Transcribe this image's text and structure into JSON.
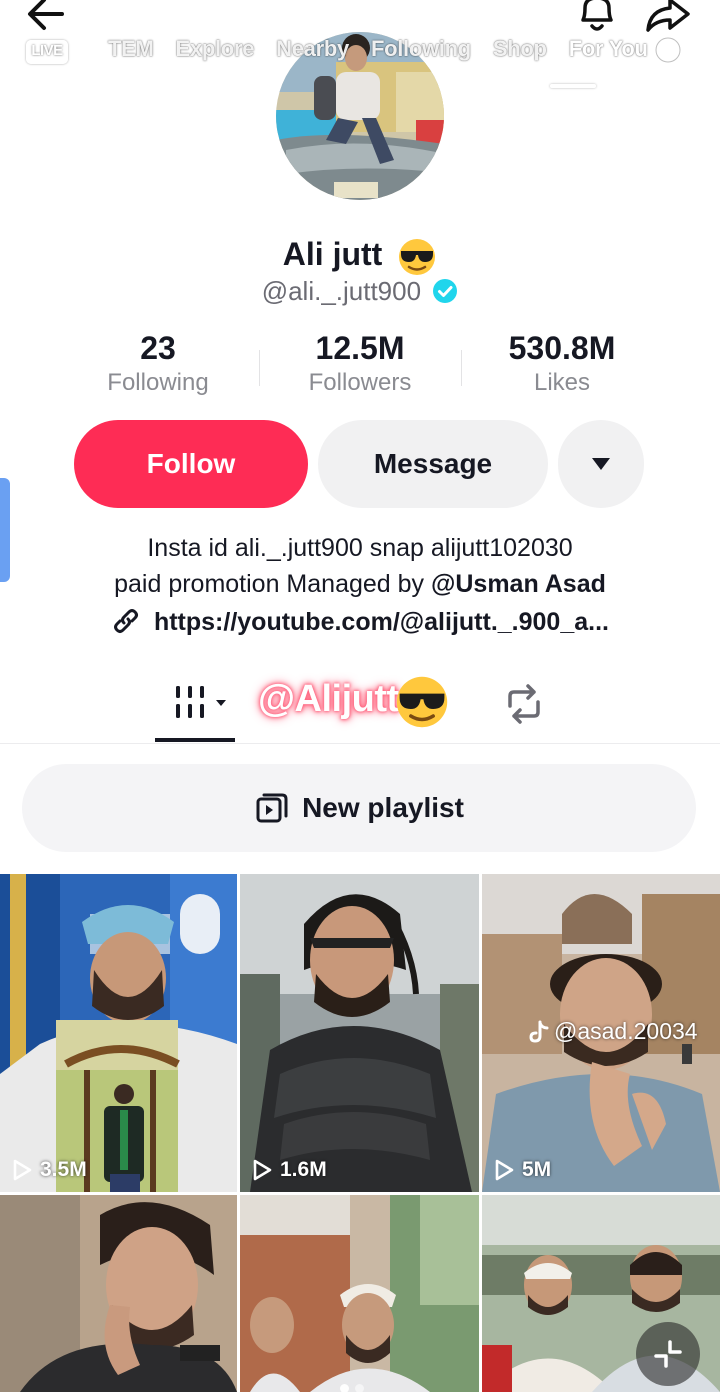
{
  "top_nav": {
    "live_label": "LIVE",
    "tabs": [
      "TEM",
      "Explore",
      "Nearby",
      "Following",
      "Shop",
      "For You"
    ],
    "active_tab": "For You"
  },
  "profile": {
    "name": "Ali jutt",
    "name_emoji": "sunglasses-emoji",
    "handle": "@ali._.jutt900",
    "verified": true
  },
  "stats": [
    {
      "value": "23",
      "label": "Following"
    },
    {
      "value": "12.5M",
      "label": "Followers"
    },
    {
      "value": "530.8M",
      "label": "Likes"
    }
  ],
  "actions": {
    "follow_label": "Follow",
    "message_label": "Message"
  },
  "bio": {
    "line1": "Insta id ali._.jutt900 snap alijutt102030",
    "line2_prefix": "paid promotion Managed by ",
    "line2_mention": "@Usman Asad",
    "link": "https://youtube.com/@alijutt._.900_a..."
  },
  "content_tabs": {
    "watermark_text": "@Alijutt"
  },
  "playlist": {
    "label": "New playlist"
  },
  "videos": [
    {
      "views": "3.5M"
    },
    {
      "views": "1.6M"
    },
    {
      "views": "5M"
    },
    {
      "views": ""
    },
    {
      "views": ""
    },
    {
      "views": ""
    }
  ],
  "video_watermark": "@asad.20034",
  "colors": {
    "follow": "#fe2c55",
    "verified": "#20d5ec",
    "text": "#161823",
    "muted": "#8a8b91"
  }
}
